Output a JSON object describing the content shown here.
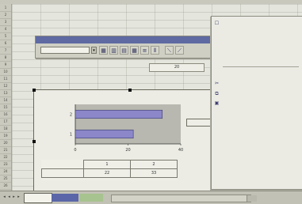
{
  "sheet": {
    "row_numbers": [
      "1",
      "2",
      "3",
      "4",
      "5",
      "6",
      "7",
      "8",
      "9",
      "10",
      "11",
      "12",
      "13",
      "14",
      "15",
      "16",
      "17",
      "18",
      "19",
      "20",
      "21",
      "22",
      "23",
      "24",
      "25",
      "26"
    ]
  },
  "toolbar": {
    "title": "",
    "object_combo_value": "",
    "buttons": [
      {
        "name": "format-selected-object-button",
        "icon": "format-icon",
        "glyph": "▦"
      },
      {
        "name": "chart-type-button",
        "icon": "chart-type-icon",
        "glyph": "▥"
      },
      {
        "name": "legend-button",
        "icon": "legend-icon",
        "glyph": "▤"
      },
      {
        "name": "data-table-button",
        "icon": "data-table-icon",
        "glyph": "▦"
      },
      {
        "name": "by-row-button",
        "icon": "by-row-icon",
        "glyph": "≡"
      },
      {
        "name": "by-column-button",
        "icon": "by-column-icon",
        "glyph": "⦀"
      },
      {
        "name": "angle-text-down-button",
        "icon": "angle-down-icon",
        "glyph": "⟍"
      },
      {
        "name": "angle-text-up-button",
        "icon": "angle-up-icon",
        "glyph": "⟋"
      }
    ]
  },
  "cells": {
    "range_box": "20"
  },
  "chart_data": {
    "type": "bar",
    "orientation": "horizontal",
    "categories": [
      "1",
      "2"
    ],
    "values": [
      22,
      33
    ],
    "series_name": "",
    "xlim": [
      0,
      40
    ],
    "x_ticks": [
      "0",
      "20",
      "40"
    ],
    "grid": false,
    "data_table": {
      "header": [
        "1",
        "2"
      ],
      "row_label": "",
      "row_values": [
        "22",
        "33"
      ]
    },
    "colors": {
      "bar": "#8b87c9",
      "plot_bg": "#b8b8b0"
    }
  },
  "sheet_tabs": [
    {
      "label": "",
      "active": true
    },
    {
      "label": "",
      "active": false,
      "color": "#5a66a8"
    },
    {
      "label": "",
      "active": false,
      "color": "#a7c38f"
    }
  ],
  "context_menu": {
    "items": [
      {
        "label": "",
        "icon": "format-icon",
        "glyph": "☐"
      },
      {
        "label": "",
        "icon": "",
        "glyph": ""
      },
      {
        "label": "",
        "icon": "",
        "glyph": ""
      },
      {
        "label": "",
        "icon": "",
        "glyph": ""
      },
      {
        "label": "",
        "icon": "",
        "glyph": ""
      },
      {
        "separator": true
      },
      {
        "label": "",
        "icon": "",
        "glyph": ""
      },
      {
        "label": "",
        "icon": "cut-icon",
        "glyph": "✂"
      },
      {
        "label": "",
        "icon": "copy-icon",
        "glyph": "⧉"
      },
      {
        "label": "",
        "icon": "paste-icon",
        "glyph": "▣"
      },
      {
        "label": "",
        "icon": "",
        "glyph": ""
      },
      {
        "label": "",
        "icon": "",
        "glyph": ""
      },
      {
        "label": "",
        "icon": "",
        "glyph": ""
      },
      {
        "label": "",
        "icon": "",
        "glyph": ""
      },
      {
        "label": "",
        "icon": "",
        "glyph": ""
      }
    ]
  }
}
